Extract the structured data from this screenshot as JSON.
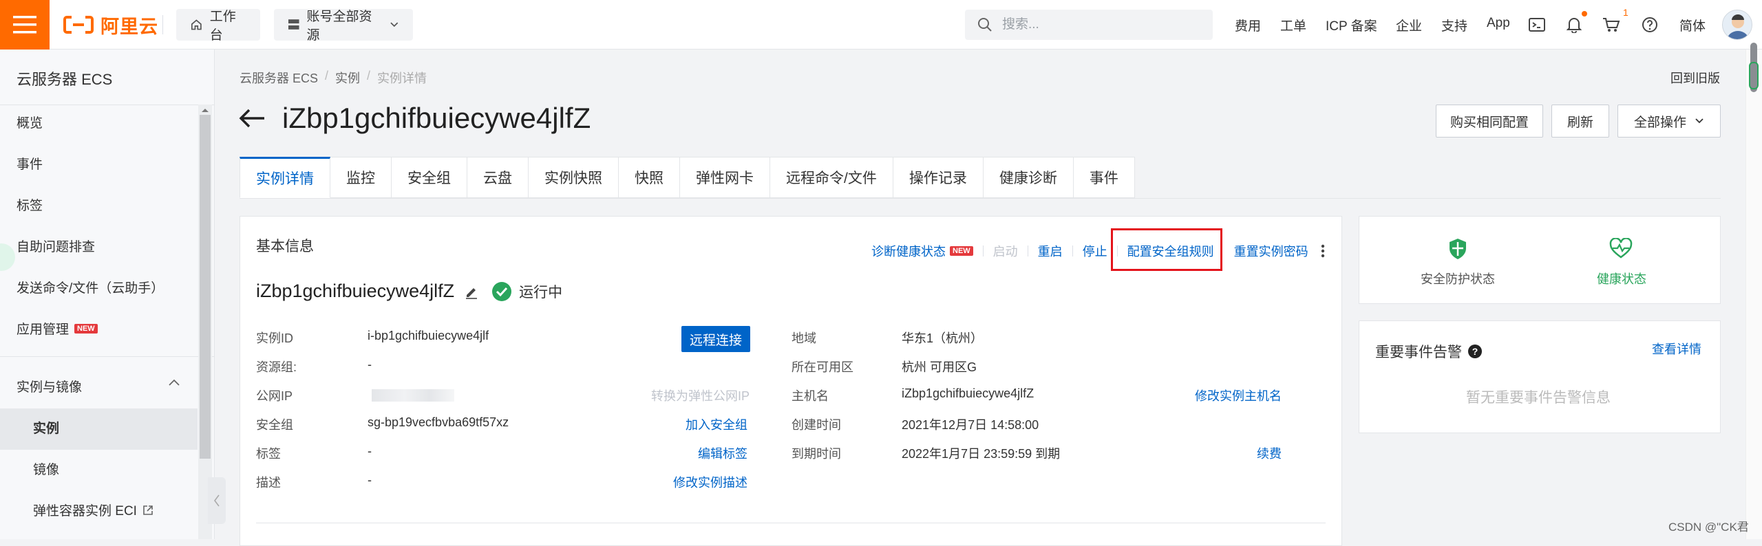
{
  "topbar": {
    "logo_text": "阿里云",
    "workbench": "工作台",
    "all_resources": "账号全部资源",
    "search_placeholder": "搜索...",
    "links": [
      "费用",
      "工单",
      "ICP 备案",
      "企业",
      "支持",
      "App"
    ],
    "cart_badge": "1",
    "language": "简体"
  },
  "sidebar": {
    "title": "云服务器 ECS",
    "items": [
      "概览",
      "事件",
      "标签",
      "自助问题排查",
      "发送命令/文件（云助手）",
      "应用管理"
    ],
    "new_tag": "NEW",
    "group": "实例与镜像",
    "sub_items": [
      "实例",
      "镜像",
      "弹性容器实例 ECI"
    ]
  },
  "breadcrumb": [
    "云服务器 ECS",
    "实例",
    "实例详情"
  ],
  "old_version": "回到旧版",
  "page_title": "iZbp1gchifbuiecywe4jlfZ",
  "actions": {
    "buy_same": "购买相同配置",
    "refresh": "刷新",
    "all_ops": "全部操作"
  },
  "tabs": [
    "实例详情",
    "监控",
    "安全组",
    "云盘",
    "实例快照",
    "快照",
    "弹性网卡",
    "远程命令/文件",
    "操作记录",
    "健康诊断",
    "事件"
  ],
  "basic_info": {
    "title": "基本信息",
    "ops": {
      "diagnose": "诊断健康状态",
      "new_tag": "NEW",
      "start": "启动",
      "restart": "重启",
      "stop": "停止",
      "config_sg": "配置安全组规则",
      "reset_pwd": "重置实例密码"
    },
    "instance_name": "iZbp1gchifbuiecywe4jlfZ",
    "status": "运行中",
    "left_rows": [
      {
        "label": "实例ID",
        "value": "i-bp1gchifbuiecywe4jlf",
        "action": "远程连接"
      },
      {
        "label": "资源组:",
        "value": "-",
        "action": ""
      },
      {
        "label": "公网IP",
        "value": "",
        "action": "转换为弹性公网IP"
      },
      {
        "label": "安全组",
        "value": "sg-bp19vecfbvba69tf57xz",
        "action": "加入安全组"
      },
      {
        "label": "标签",
        "value": "-",
        "action": "编辑标签"
      },
      {
        "label": "描述",
        "value": "-",
        "action": "修改实例描述"
      }
    ],
    "right_rows": [
      {
        "label": "地域",
        "value": "华东1（杭州）",
        "action": ""
      },
      {
        "label": "所在可用区",
        "value": "杭州 可用区G",
        "action": ""
      },
      {
        "label": "主机名",
        "value": "iZbp1gchifbuiecywe4jlfZ",
        "action": "修改实例主机名"
      },
      {
        "label": "创建时间",
        "value": "2021年12月7日 14:58:00",
        "action": ""
      },
      {
        "label": "到期时间",
        "value": "2022年1月7日 23:59:59 到期",
        "action": "续费"
      }
    ]
  },
  "side": {
    "security_label": "安全防护状态",
    "health_label": "健康状态",
    "events_title": "重要事件告警",
    "events_link": "查看详情",
    "events_empty": "暂无重要事件告警信息"
  },
  "watermark": "CSDN @\"CK君",
  "colors": {
    "brand": "#ff6a00",
    "link": "#0064c8",
    "success": "#2aa55c",
    "highlight": "#e4141b"
  }
}
